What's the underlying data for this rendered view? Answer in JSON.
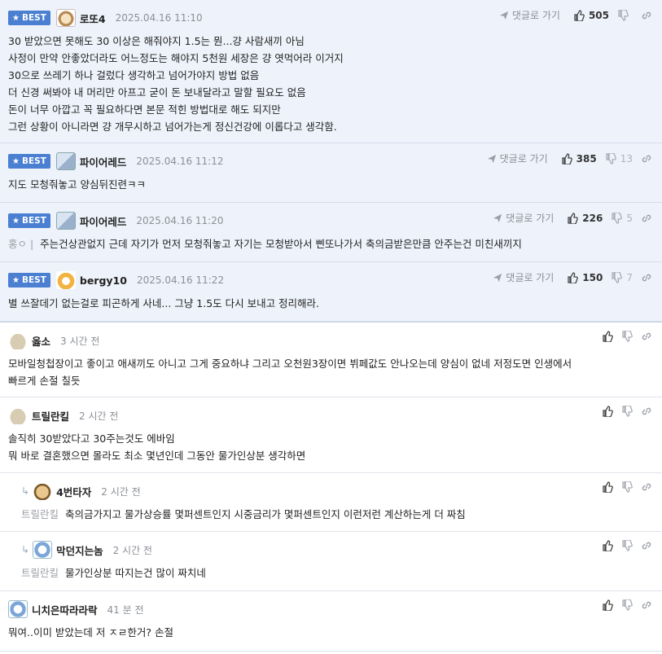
{
  "best_label": "BEST",
  "goto_label": "댓글로 가기",
  "comments": [
    {
      "nick": "로또4",
      "date": "2025.04.16 11:10",
      "up": "505",
      "down": "",
      "lines": [
        "30 받았으면 못해도 30 이상은 해줘야지 1.5는 뭔...걍 사람새끼 아님",
        "사정이 만약 안좋았더라도 어느정도는 해야지 5천원 세장은 걍 엿먹어라 이거지",
        "30으로 쓰레기 하나 걸렀다 생각하고 넘어가야지 방법 없음",
        "더 신경 써봐야 내 머리만 아프고 굳이 돈 보내달라고 말할 필요도 없음",
        "돈이 너무 아깝고 꼭 필요하다면 본문 적힌 방법대로 해도 되지만",
        "그런 상황이 아니라면 걍 개무시하고 넘어가는게 정신건강에 이롭다고 생각함."
      ]
    },
    {
      "nick": "파이어레드",
      "date": "2025.04.16 11:12",
      "up": "385",
      "down": "13",
      "lines": [
        "지도 모청줘놓고 양심뒤진련ㅋㅋ"
      ]
    },
    {
      "nick": "파이어레드",
      "date": "2025.04.16 11:20",
      "up": "226",
      "down": "5",
      "mention": "홍ㅇ |",
      "lines": [
        "주는건상관없지 근데 자기가 먼저 모청줘놓고 자기는 모청받아서 삔또나가서 축의금받은만큼 안주는건 미친새끼지"
      ]
    },
    {
      "nick": "bergy10",
      "date": "2025.04.16 11:22",
      "up": "150",
      "down": "7",
      "lines": [
        "별 쓰잘데기 없는걸로 피곤하게 사네... 그냥 1.5도 다시 보내고 정리해라."
      ]
    },
    {
      "nick": "옳소",
      "date": "3 시간 전",
      "lines": [
        "모바일청첩장이고 좋이고 애새끼도 아니고 그게 중요하냐 그리고 오천원3장이면 뷔페값도 안나오는데 양심이 없네 저정도면 인생에서",
        "빠르게 손절 칠듯"
      ]
    },
    {
      "nick": "트릴란킬",
      "date": "2 시간 전",
      "lines": [
        "솔직히 30받았다고 30주는것도 에바임",
        "뭐 바로 결혼했으면 몰라도 최소 몇년인데 그동안 물가인상분 생각하면"
      ]
    },
    {
      "nick": "4번타자",
      "date": "2 시간 전",
      "mention": "트릴란킬",
      "lines": [
        "축의금가지고 물가상승률 몇퍼센트인지 시중금리가 몇퍼센트인지 이런저런 계산하는게 더 짜침"
      ]
    },
    {
      "nick": "막던지는놈",
      "date": "2 시간 전",
      "mention": "트릴란킬",
      "lines": [
        "물가인상분 따지는건 많이 짜치네"
      ]
    },
    {
      "nick": "니치은따라라락",
      "date": "41 분 전",
      "lines": [
        "뭐여..이미 받았는데 저 ㅈㄹ한거? 손절"
      ]
    }
  ]
}
